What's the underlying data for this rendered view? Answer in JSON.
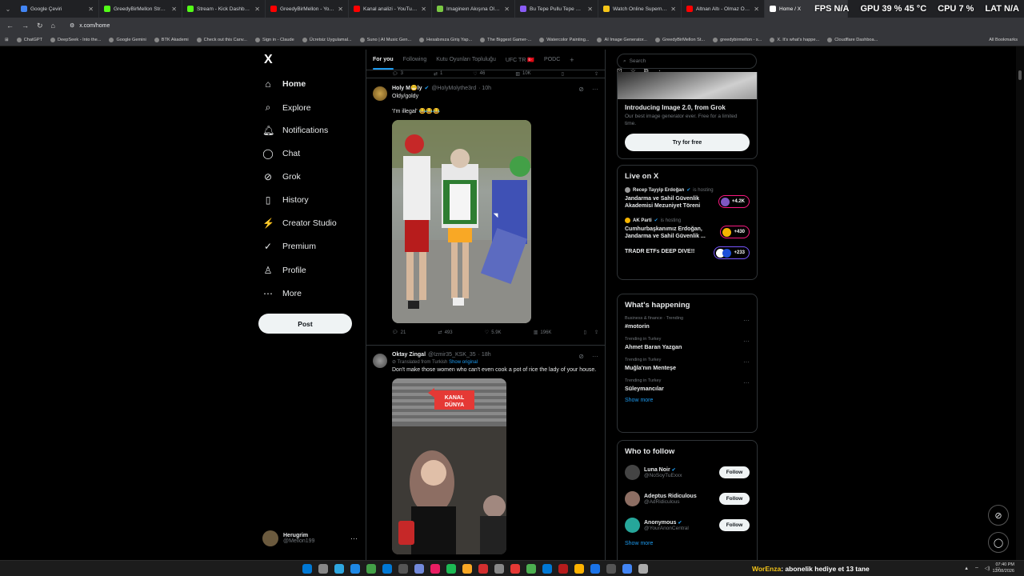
{
  "browser": {
    "tabs": [
      {
        "title": "Google Çeviri",
        "color": "#4285f4",
        "active": false
      },
      {
        "title": "GreedyBirMellon Stream",
        "color": "#53fc18",
        "active": false
      },
      {
        "title": "Stream - Kick Dashboard",
        "color": "#53fc18",
        "active": false
      },
      {
        "title": "GreedyBirMellon - YouTube",
        "color": "#ff0000",
        "active": false
      },
      {
        "title": "Kanal analizi - YouTube St",
        "color": "#ff0000",
        "active": false
      },
      {
        "title": "Imagineın Akışına Öldürün",
        "color": "#7ac943",
        "active": false
      },
      {
        "title": "Bu Tepe Pullu Tepe Notalı",
        "color": "#8a5cf6",
        "active": false
      },
      {
        "title": "Watch Online Supernatural",
        "color": "#f5c518",
        "active": false
      },
      {
        "title": "Altnan Altı - Olmaz Öyle",
        "color": "#ff0000",
        "active": false
      },
      {
        "title": "Home / X",
        "color": "#ffffff",
        "active": true
      }
    ],
    "url": "x.com/home",
    "overlay": {
      "fps": "FPS",
      "fps_val": "N/A",
      "gpu": "GPU 39 % 45 °C",
      "cpu": "CPU",
      "cpu_val": "7 %",
      "lat": "LAT",
      "lat_val": "N/A"
    },
    "bookmarks": [
      "ChatGPT",
      "DeepSeek - Into the...",
      "Google Gemini",
      "BTK Akademi",
      "Check out this Canv...",
      "Sign in - Claude",
      "Ücretsiz Uygulamal...",
      "Suno | AI Music Gen...",
      "Hesabınıza Giriş Yap...",
      "The Biggest Gamer-...",
      "Watercolor Painting...",
      "AI Image Generator...",
      "GreedyBirMellon St...",
      "greedybirmellon - s...",
      "X. It's what's happe...",
      "Cloudflare Dashboa..."
    ],
    "all_bookmarks": "All Bookmarks"
  },
  "nav": {
    "logo": "X",
    "items": [
      {
        "label": "Home",
        "icon": "⌂"
      },
      {
        "label": "Explore",
        "icon": "⌕"
      },
      {
        "label": "Notifications",
        "icon": "🔔︎"
      },
      {
        "label": "Chat",
        "icon": "◯"
      },
      {
        "label": "Grok",
        "icon": "⊘"
      },
      {
        "label": "History",
        "icon": "▯"
      },
      {
        "label": "Creator Studio",
        "icon": "⚡"
      },
      {
        "label": "Premium",
        "icon": "✓"
      },
      {
        "label": "Profile",
        "icon": "♙"
      },
      {
        "label": "More",
        "icon": "⋯"
      }
    ],
    "post": "Post",
    "profile_name": "Herugrim",
    "profile_handle": "@Mellon199"
  },
  "feed": {
    "tabs": [
      "For you",
      "Following",
      "Kutu Oyunları Topluluğu",
      "UFC TR 🇹🇷",
      "PODC",
      "+"
    ],
    "top_metrics": [
      "3",
      "1",
      "46",
      "10K"
    ],
    "tweets": [
      {
        "name": "Holy M😁ly",
        "handle": "@HolyMolythe3rd",
        "time": "· 10h",
        "text1": "Oldy/goldy",
        "text2": "'I'm illegal' 😂😂😂",
        "metrics": [
          "21",
          "493",
          "5.9K",
          "196K"
        ]
      },
      {
        "name": "Oktay Zingal",
        "handle": "@Izmir35_KSK_35",
        "time": "· 18h",
        "translated": "Translated from Turkish",
        "show_original": "Show original",
        "text1": "Don't make those women who can't even cook a pot of rice the lady of your house.",
        "media_brand": "KANAL DÜNYA"
      }
    ]
  },
  "right": {
    "search_placeholder": "Search",
    "grok": {
      "title": "Introducing Image 2.0, from Grok",
      "desc": "Our best image generator ever. Free for a limited time.",
      "cta": "Try for free"
    },
    "live": {
      "title": "Live on X",
      "items": [
        {
          "host": "Recep Tayyip Erdoğan",
          "is": "is hosting",
          "title": "Jandarma ve Sahil Güvenlik Akademisi Mezuniyet Töreni",
          "count": "+4.2K"
        },
        {
          "host": "AK Parti",
          "is": "is hosting",
          "title": "Cumhurbaşkanımız Erdoğan, Jandarma ve Sahil Güvenlik ...",
          "count": "+430"
        },
        {
          "host": "",
          "is": "",
          "title": "TRADR ETFs DEEP DIVE!!",
          "count": "+233"
        }
      ]
    },
    "happening": {
      "title": "What's happening",
      "items": [
        {
          "cat": "Business & finance · Trending",
          "name": "#motorin"
        },
        {
          "cat": "Trending in Turkey",
          "name": "Ahmet Baran Yazgan"
        },
        {
          "cat": "Trending in Turkey",
          "name": "Muğla'nın Menteşe"
        },
        {
          "cat": "Trending in Turkey",
          "name": "Süleymancılar"
        }
      ],
      "show_more": "Show more"
    },
    "who": {
      "title": "Who to follow",
      "items": [
        {
          "name": "Luna Noir",
          "handle": "@NoSoyTuExxx",
          "cta": "Follow"
        },
        {
          "name": "Adeptus Ridiculous",
          "handle": "@AdRidiculous",
          "cta": "Follow"
        },
        {
          "name": "Anonymous",
          "handle": "@YourAnonCentral",
          "cta": "Follow"
        }
      ],
      "show_more": "Show more"
    }
  },
  "taskbar": {
    "ticker_user": "WorEnza",
    "ticker_text": ": abonelik hediye et 13 tane",
    "time": "07:40 PM",
    "date": "13/08/2026"
  }
}
